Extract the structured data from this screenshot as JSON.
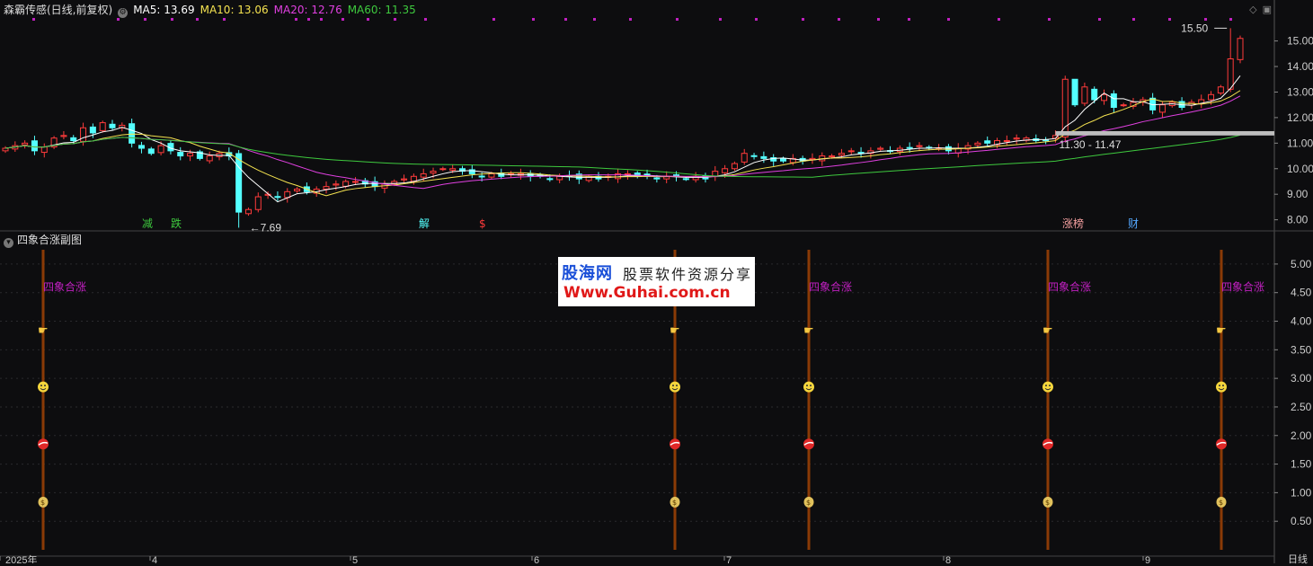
{
  "header": {
    "title": "森霸传感(日线,前复权)",
    "ma5": "MA5: 13.69",
    "ma10": "MA10: 13.06",
    "ma20": "MA20: 12.76",
    "ma60": "MA60: 11.35"
  },
  "sub_header": {
    "title": "四象合涨副图"
  },
  "watermark": {
    "line1": "股海网",
    "line1b": "股票软件资源分享",
    "line2": "Www.Guhai.com.cn"
  },
  "corner_label": "日线",
  "top_right_icons": [
    "diamond-icon",
    "panel-toggle-icon"
  ],
  "colors": {
    "background": "#0d0d0f",
    "up": "#ff3b3b",
    "down": "#54ffff",
    "ma5": "#ffffff",
    "ma10": "#f5e350",
    "ma20": "#e040e0",
    "ma60": "#3ec93e",
    "signal": "#c020c0",
    "stem": "#8a3a06"
  },
  "chart_data": [
    {
      "type": "candlestick",
      "title": "森霸传感(日线,前复权)",
      "y_ticks": [
        "15.00",
        "14.00",
        "13.00",
        "12.00",
        "11.00",
        "10.00",
        "9.00",
        "8.00"
      ],
      "ylim": [
        7.6,
        15.9
      ],
      "x_ticks": [
        "2025年",
        "4",
        "5",
        "6",
        "7",
        "8",
        "9"
      ],
      "legend": [
        "MA5: 13.69",
        "MA10: 13.06",
        "MA20: 12.76",
        "MA60: 11.35"
      ],
      "close_series": [
        10.8,
        10.9,
        11.0,
        10.7,
        10.85,
        11.2,
        11.3,
        11.1,
        11.6,
        11.4,
        11.8,
        11.6,
        11.7,
        11.0,
        10.8,
        10.6,
        10.9,
        10.7,
        10.5,
        10.6,
        10.4,
        10.5,
        10.6,
        10.5,
        8.3,
        8.4,
        8.9,
        9.0,
        8.9,
        9.1,
        9.2,
        9.1,
        9.2,
        9.3,
        9.4,
        9.5,
        9.5,
        9.4,
        9.3,
        9.4,
        9.5,
        9.6,
        9.7,
        9.8,
        9.9,
        10.0,
        10.0,
        9.9,
        9.8,
        9.7,
        9.8,
        9.7,
        9.8,
        9.8,
        9.7,
        9.7,
        9.6,
        9.7,
        9.7,
        9.6,
        9.7,
        9.6,
        9.7,
        9.8,
        9.8,
        9.7,
        9.7,
        9.6,
        9.7,
        9.7,
        9.6,
        9.7,
        9.6,
        9.9,
        10.0,
        10.2,
        10.6,
        10.5,
        10.4,
        10.3,
        10.3,
        10.4,
        10.3,
        10.4,
        10.5,
        10.5,
        10.6,
        10.7,
        10.6,
        10.7,
        10.8,
        10.7,
        10.8,
        10.8,
        10.9,
        10.8,
        10.8,
        10.7,
        10.8,
        10.9,
        11.0,
        11.0,
        11.1,
        11.1,
        11.2,
        11.2,
        11.1,
        11.1,
        11.3,
        13.5,
        12.5,
        13.2,
        12.7,
        12.9,
        12.4,
        12.5,
        12.6,
        12.7,
        12.3,
        12.5,
        12.6,
        12.4,
        12.6,
        12.7,
        12.9,
        13.2,
        14.3,
        15.1
      ],
      "annotations": [
        {
          "text": "15.50",
          "value": 15.5
        },
        {
          "text": "7.69",
          "value": 7.69
        },
        {
          "text": "11.30 - 11.47",
          "value": 11.38
        }
      ],
      "signals": [
        {
          "text": "减",
          "color": "#3ec93e"
        },
        {
          "text": "跌",
          "color": "#3ec93e"
        },
        {
          "text": "解",
          "color": "#54ffff"
        },
        {
          "text": "$",
          "color": "#ff3b3b"
        },
        {
          "text": "涨榜",
          "color": "#f5a0a0"
        },
        {
          "text": "财",
          "color": "#54a8ff"
        }
      ]
    },
    {
      "type": "indicator",
      "title": "四象合涨副图",
      "y_ticks": [
        "5.00",
        "4.50",
        "4.00",
        "3.50",
        "3.00",
        "2.50",
        "2.00",
        "1.50",
        "1.00",
        "0.50"
      ],
      "ylim": [
        0,
        5.25
      ],
      "label": "四象合涨",
      "icon_levels": [
        {
          "icon": "hand-pointer-icon",
          "value": 3.85
        },
        {
          "icon": "smiley-icon",
          "value": 2.85
        },
        {
          "icon": "ball-icon",
          "value": 1.85
        },
        {
          "icon": "money-bag-icon",
          "value": 0.85
        }
      ]
    }
  ]
}
